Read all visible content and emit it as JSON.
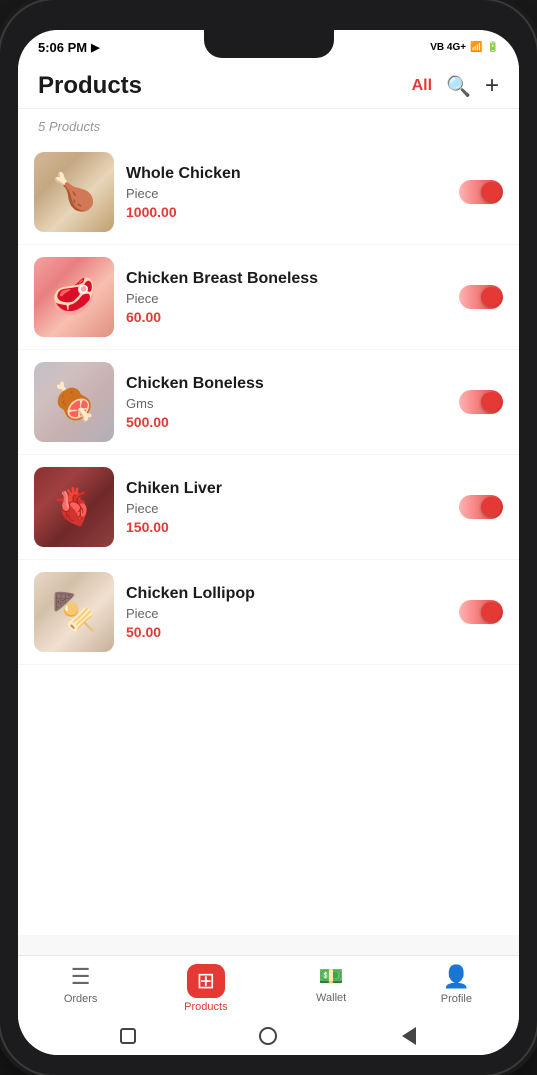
{
  "status_bar": {
    "time": "5:06 PM",
    "signal": "VB 4G+"
  },
  "header": {
    "title": "Products",
    "filter_label": "All",
    "search_icon": "🔍",
    "add_icon": "+"
  },
  "products_section": {
    "count_label": "5 Products"
  },
  "products": [
    {
      "id": 1,
      "name": "Whole Chicken",
      "unit": "Piece",
      "price": "1000.00",
      "img_class": "img-whole-chicken",
      "emoji": "🍗",
      "enabled": true
    },
    {
      "id": 2,
      "name": "Chicken Breast Boneless",
      "unit": "Piece",
      "price": "60.00",
      "img_class": "img-chicken-breast",
      "emoji": "🥩",
      "enabled": true
    },
    {
      "id": 3,
      "name": "Chicken Boneless",
      "unit": "Gms",
      "price": "500.00",
      "img_class": "img-chicken-boneless",
      "emoji": "🍖",
      "enabled": true
    },
    {
      "id": 4,
      "name": "Chiken Liver",
      "unit": "Piece",
      "price": "150.00",
      "img_class": "img-chicken-liver",
      "emoji": "🫀",
      "enabled": true
    },
    {
      "id": 5,
      "name": "Chicken Lollipop",
      "unit": "Piece",
      "price": "50.00",
      "img_class": "img-chicken-lollipop",
      "emoji": "🍢",
      "enabled": true
    }
  ],
  "bottom_nav": {
    "items": [
      {
        "id": "orders",
        "label": "Orders",
        "icon": "≡",
        "active": false
      },
      {
        "id": "products",
        "label": "Products",
        "icon": "⊞",
        "active": true
      },
      {
        "id": "wallet",
        "label": "Wallet",
        "icon": "$",
        "active": false
      },
      {
        "id": "profile",
        "label": "Profile",
        "icon": "👤",
        "active": false
      }
    ]
  },
  "colors": {
    "accent": "#e53935",
    "text_primary": "#1a1a1a",
    "text_secondary": "#666666",
    "text_muted": "#999999"
  }
}
